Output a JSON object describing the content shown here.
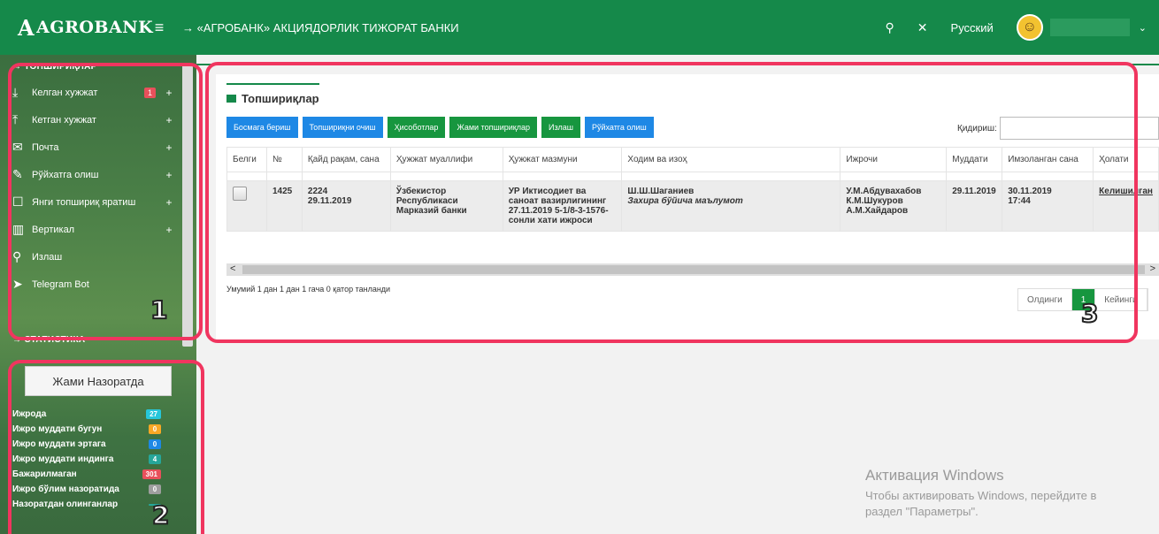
{
  "header": {
    "logo_glyph": "A",
    "logo_text": "AGROBANK",
    "menu_icon": "≡",
    "bank_title": "→ «АГРОБАНК» АКЦИЯДОРЛИК ТИЖОРАТ БАНКИ",
    "search_icon": "⚲",
    "fullscreen_icon": "✕",
    "language": "Русский",
    "chevron": "⌄",
    "avatar_glyph": "☺"
  },
  "sidebar": {
    "tasks_heading": "→ ТОПШИРИҚЛАР",
    "items": [
      {
        "icon": "⤓",
        "label": "Келган хужжат",
        "badge": "1",
        "plus": "+"
      },
      {
        "icon": "⤒",
        "label": "Кетган хужжат",
        "plus": "+"
      },
      {
        "icon": "✉",
        "label": "Почта",
        "plus": "+"
      },
      {
        "icon": "✎",
        "label": "Рўйхатга олиш",
        "plus": "+"
      },
      {
        "icon": "☐",
        "label": "Янги топшириқ яратиш",
        "plus": "+"
      },
      {
        "icon": "▥",
        "label": "Вертикал",
        "plus": "+"
      },
      {
        "icon": "⚲",
        "label": "Излаш"
      },
      {
        "icon": "➤",
        "label": "Telegram Bot"
      }
    ],
    "stats_heading": "→ СТАТИСТИКА",
    "stats_button": "Жами Назоратда",
    "stats": [
      {
        "label": "Ижрода",
        "count": "27",
        "color": "#26c6da"
      },
      {
        "label": "Ижро муддати бугун",
        "count": "0",
        "color": "#f9a825"
      },
      {
        "label": "Ижро муддати эртага",
        "count": "0",
        "color": "#1e88e5"
      },
      {
        "label": "Ижро муддати индинга",
        "count": "4",
        "color": "#26a69a"
      },
      {
        "label": "Бажарилмаган",
        "count": "301",
        "color": "#e8505b"
      },
      {
        "label": "Ижро бўлим назоратида",
        "count": "0",
        "color": "#9e9e9e"
      },
      {
        "label": "Назоратдан олинганлар",
        "count": "",
        "color": "#26a69a"
      }
    ]
  },
  "annotations": {
    "one": "1",
    "two": "2",
    "three": "3"
  },
  "main": {
    "title": "Топшириқлар",
    "toolbar": [
      {
        "label": "Босмага бериш",
        "color": "blue"
      },
      {
        "label": "Топшириқни очиш",
        "color": "blue"
      },
      {
        "label": "Ҳисоботлар",
        "color": "green"
      },
      {
        "label": "Жами топшириқлар",
        "color": "green"
      },
      {
        "label": "Излаш",
        "color": "green"
      },
      {
        "label": "Рўйхатга олиш",
        "color": "blue"
      }
    ],
    "search_label": "Қидириш:",
    "columns": [
      "Белги",
      "№",
      "Қайд рақам, сана",
      "Ҳужжат муаллифи",
      "Ҳужжат мазмуни",
      "Ходим ва изоҳ",
      "Ижрочи",
      "Муддати",
      "Имзоланган сана",
      "Ҳолати"
    ],
    "row": {
      "num": "1425",
      "reg_number": "2224",
      "reg_date": "29.11.2019",
      "author": "Ўзбекистор Республикаси Марказий банки",
      "content": "УР Иктисодиет ва саноат вазирлигининг 27.11.2019 5-1/8-3-1576-сонли хати ижроси",
      "employee": "Ш.Ш.Шаганиев",
      "note": "Захира бўйича маълумот",
      "executors": [
        "У.М.Абдувахабов",
        "К.М.Шукуров",
        "А.М.Хайдаров"
      ],
      "deadline": "29.11.2019",
      "signed_date": "30.11.2019",
      "signed_time": "17:44",
      "status": "Келишилган"
    },
    "scroll_left": "<",
    "scroll_right": ">",
    "info": "Умумий 1 дан 1 дан 1 гача   0 қатор танланди",
    "pager": {
      "prev": "Олдинги",
      "current": "1",
      "next": "Кейинги"
    }
  },
  "windows_activation": {
    "title": "Активация Windows",
    "line1": "Чтобы активировать Windows, перейдите в",
    "line2": "раздел \"Параметры\"."
  }
}
